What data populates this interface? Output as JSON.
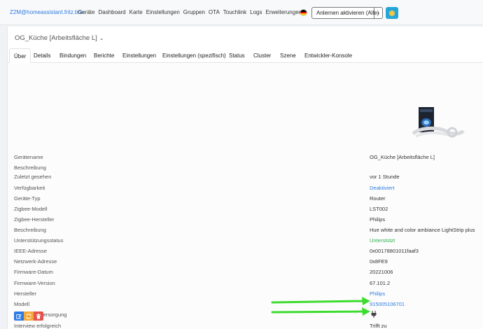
{
  "navbar": {
    "brand": "Z2M@homeassistant.fritz.box",
    "links": [
      "Geräte",
      "Dashboard",
      "Karte",
      "Einstellungen",
      "Gruppen",
      "OTA",
      "Touchlink",
      "Logs",
      "Erweiterungen"
    ],
    "permit_join": "Anlernen aktivieren (Alle)"
  },
  "device": {
    "title": "OG_Küche [Arbeitsfläche L]"
  },
  "tabs": [
    "Über",
    "Details",
    "Bindungen",
    "Berichte",
    "Einstellungen",
    "Einstellungen (spezifisch)",
    "Status",
    "Cluster",
    "Szene",
    "Entwickler-Konsole"
  ],
  "active_tab": "Über",
  "info": [
    {
      "label": "Gerätename",
      "value": "OG_Küche [Arbeitsfläche L]",
      "style": "text"
    },
    {
      "label": "Beschreibung",
      "value": "",
      "style": "text"
    },
    {
      "label": "Zuletzt gesehen",
      "value": "vor 1 Stunde",
      "style": "text"
    },
    {
      "label": "Verfügbarkeit",
      "value": "Deaktiviert",
      "style": "link"
    },
    {
      "label": "Geräte-Typ",
      "value": "Router",
      "style": "text"
    },
    {
      "label": "Zigbee-Modell",
      "value": "LST002",
      "style": "text"
    },
    {
      "label": "Zigbee-Hersteller",
      "value": "Philips",
      "style": "text"
    },
    {
      "label": "Beschreibung",
      "value": "Hue white and color ambiance LightStrip plus",
      "style": "text"
    },
    {
      "label": "Unterstützungsstatus",
      "value": "Unterstützt",
      "style": "ok"
    },
    {
      "label": "IEEE-Adresse",
      "value": "0x00178801011faaf3",
      "style": "text"
    },
    {
      "label": "Netzwerk-Adresse",
      "value": "0x8FE9",
      "style": "text"
    },
    {
      "label": "Firmware-Datum",
      "value": "20221006",
      "style": "text"
    },
    {
      "label": "Firmware-Version",
      "value": "67.101.2",
      "style": "text"
    },
    {
      "label": "Hersteller",
      "value": "Philips",
      "style": "link"
    },
    {
      "label": "Modell",
      "value": "915005106701",
      "style": "link"
    },
    {
      "label": "Spannungsversorgung",
      "value": "",
      "style": "icon"
    },
    {
      "label": "Interview erfolgreich",
      "value": "Trifft zu",
      "style": "text"
    }
  ],
  "colors": {
    "link": "#2c7be5",
    "success": "#2eb34e",
    "arrow": "#3ddc2f",
    "edit_btn": "#2c7be5",
    "swap_btn": "#f5a93b",
    "delete_btn": "#e5534b"
  },
  "icons": [
    "power-plug-icon",
    "edit-icon",
    "swap-icon",
    "trash-icon",
    "chevron-down-icon",
    "sun-icon",
    "german-flag-icon"
  ]
}
